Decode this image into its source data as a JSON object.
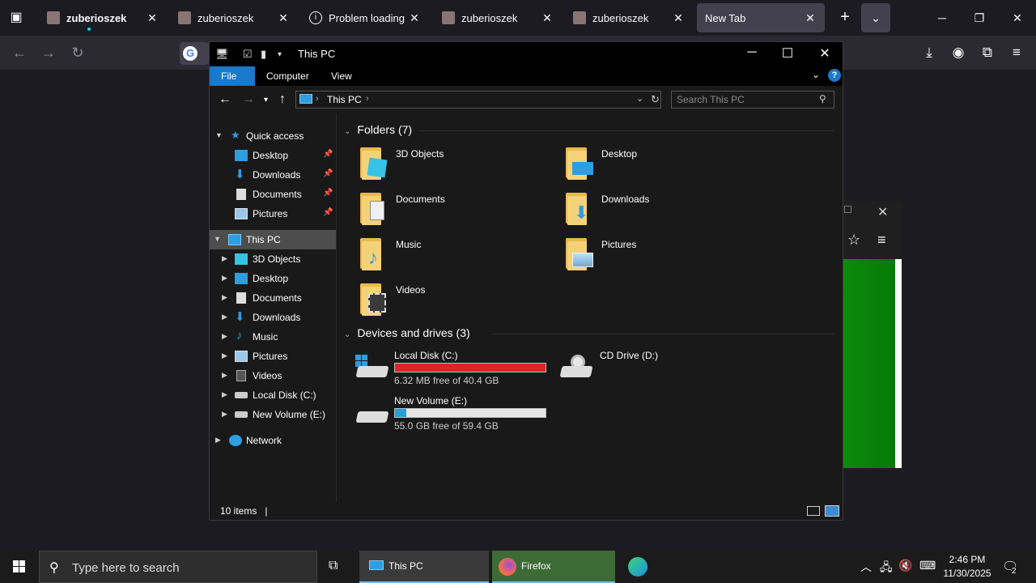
{
  "browser": {
    "tabs": [
      {
        "label": "zuberioszek",
        "bold": true,
        "active": false
      },
      {
        "label": "zuberioszek",
        "bold": false,
        "active": false
      },
      {
        "label": "Problem loading pa",
        "bold": false,
        "active": false
      },
      {
        "label": "zuberioszek",
        "bold": false,
        "active": false
      },
      {
        "label": "zuberioszek",
        "bold": false,
        "active": false
      },
      {
        "label": "New Tab",
        "bold": false,
        "active": true
      }
    ],
    "close_glyph": "✕",
    "new_tab_glyph": "+",
    "overflow_glyph": "⌄"
  },
  "explorer": {
    "title": "This PC",
    "ribbon": {
      "file": "File",
      "computer": "Computer",
      "view": "View",
      "help": "?"
    },
    "address": {
      "crumb": "This PC",
      "separator": "›"
    },
    "search_placeholder": "Search This PC",
    "nav": {
      "quick_access": "Quick access",
      "qa_items": [
        "Desktop",
        "Downloads",
        "Documents",
        "Pictures"
      ],
      "this_pc": "This PC",
      "pc_items": [
        "3D Objects",
        "Desktop",
        "Documents",
        "Downloads",
        "Music",
        "Pictures",
        "Videos",
        "Local Disk (C:)",
        "New Volume (E:)"
      ],
      "network": "Network"
    },
    "folders_header": "Folders (7)",
    "folders": [
      "3D Objects",
      "Desktop",
      "Documents",
      "Downloads",
      "Music",
      "Pictures",
      "Videos"
    ],
    "drives_header": "Devices and drives (3)",
    "drives": [
      {
        "name": "Local Disk (C:)",
        "free": "6.32 MB free of 40.4 GB",
        "used_fraction": 0.9998,
        "bar_color": "#da2626"
      },
      {
        "name": "CD Drive (D:)",
        "free": "",
        "used_fraction": null,
        "bar_color": ""
      },
      {
        "name": "New Volume (E:)",
        "free": "55.0 GB free of 59.4 GB",
        "used_fraction": 0.074,
        "bar_color": "#26a0da"
      }
    ],
    "status_count": "10 items",
    "status_cursor": "|"
  },
  "taskbar": {
    "search_placeholder": "Type here to search",
    "this_pc_label": "This PC",
    "firefox_label": "Firefox",
    "time": "2:46 PM",
    "date": "11/30/2025",
    "notification_count": "2"
  },
  "colors": {
    "accent": "#1979ca",
    "folder": "#f5d27a",
    "firefox_task": "#3d6b35"
  }
}
